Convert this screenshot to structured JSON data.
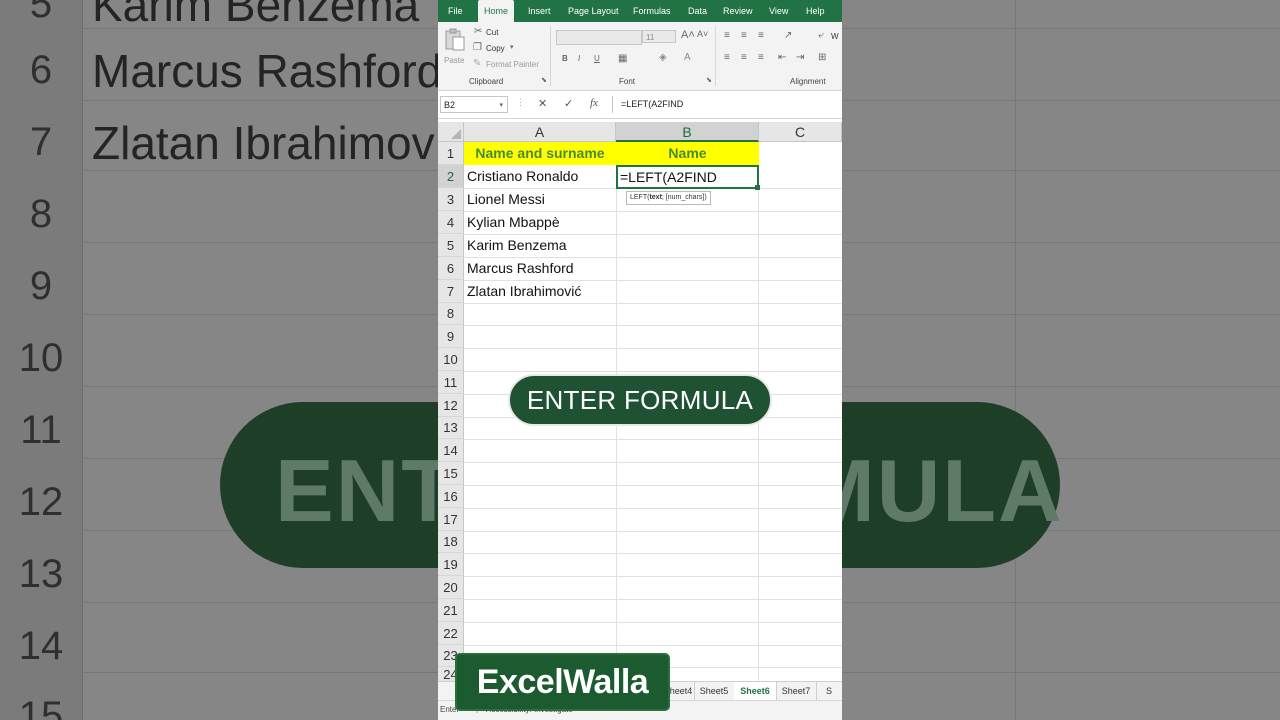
{
  "background": {
    "row_numbers": [
      "5",
      "6",
      "7",
      "8",
      "9",
      "10",
      "11",
      "12",
      "13",
      "14",
      "15"
    ],
    "names": [
      "Karim Benzema",
      "Marcus Rashford",
      "Zlatan Ibrahimov"
    ],
    "pill_text": "ENTER FORMULA"
  },
  "excel": {
    "tabs": [
      "File",
      "Home",
      "Insert",
      "Page Layout",
      "Formulas",
      "Data",
      "Review",
      "View",
      "Help"
    ],
    "active_tab": "Home",
    "clipboard": {
      "paste": "Paste",
      "cut": "Cut",
      "copy": "Copy",
      "format_painter": "Format Painter",
      "label": "Clipboard"
    },
    "font": {
      "size": "11",
      "label": "Font",
      "bold": "B",
      "italic": "I",
      "underline": "U"
    },
    "alignment": {
      "label": "Alignment",
      "wrap": "W"
    },
    "name_box": "B2",
    "formula": "=LEFT(A2FIND",
    "columns": [
      "A",
      "B",
      "C"
    ],
    "rows": [
      "1",
      "2",
      "3",
      "4",
      "5",
      "6",
      "7",
      "8",
      "9",
      "10",
      "11",
      "12",
      "13",
      "14",
      "15",
      "16",
      "17",
      "18",
      "19",
      "20",
      "21",
      "22",
      "23",
      "24"
    ],
    "header_row": {
      "a": "Name and surname",
      "b": "Name"
    },
    "names": [
      "Cristiano Ronaldo",
      "Lionel Messi",
      "Kylian Mbappè",
      "Karim Benzema",
      "Marcus Rashford",
      "Zlatan Ibrahimović"
    ],
    "active_cell_text": "=LEFT(A2FIND",
    "tooltip": {
      "fn": "LEFT(",
      "arg1": "text",
      "rest": "; [num_chars])"
    },
    "overlay": "ENTER FORMULA",
    "sheet_tabs": [
      "Sheet4",
      "Sheet5",
      "Sheet6",
      "Sheet7",
      "S"
    ],
    "active_sheet": "Sheet6",
    "status": {
      "mode": "Enter",
      "accessibility": "Accessibility: Investigate"
    }
  },
  "brand": "ExcelWalla",
  "colors": {
    "excel_green": "#217346",
    "header_yellow": "#ffff00",
    "header_text": "#4a8a35",
    "pill": "#1f5133"
  }
}
